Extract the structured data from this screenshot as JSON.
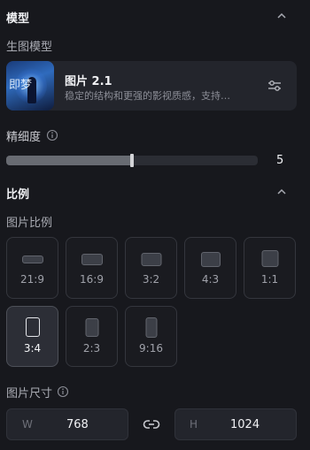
{
  "model_section": {
    "title": "模型",
    "sub_label": "生图模型"
  },
  "model_card": {
    "name": "图片 2.1",
    "description": "稳定的结构和更强的影视质感，支持…",
    "thumb_text": "即梦"
  },
  "fineness": {
    "label": "精细度",
    "value": "5",
    "fraction": 0.5
  },
  "ratio_section": {
    "title": "比例",
    "sub_label": "图片比例"
  },
  "ratios": [
    {
      "label": "21:9",
      "selected": false
    },
    {
      "label": "16:9",
      "selected": false
    },
    {
      "label": "3:2",
      "selected": false
    },
    {
      "label": "4:3",
      "selected": false
    },
    {
      "label": "1:1",
      "selected": false
    },
    {
      "label": "3:4",
      "selected": true
    },
    {
      "label": "2:3",
      "selected": false
    },
    {
      "label": "9:16",
      "selected": false
    }
  ],
  "size": {
    "label": "图片尺寸",
    "width_prefix": "W",
    "width_value": "768",
    "height_prefix": "H",
    "height_value": "1024"
  },
  "icons": {
    "collapse": "chevron-up-icon",
    "info": "info-icon",
    "settings": "sliders-icon",
    "link": "link-icon"
  }
}
